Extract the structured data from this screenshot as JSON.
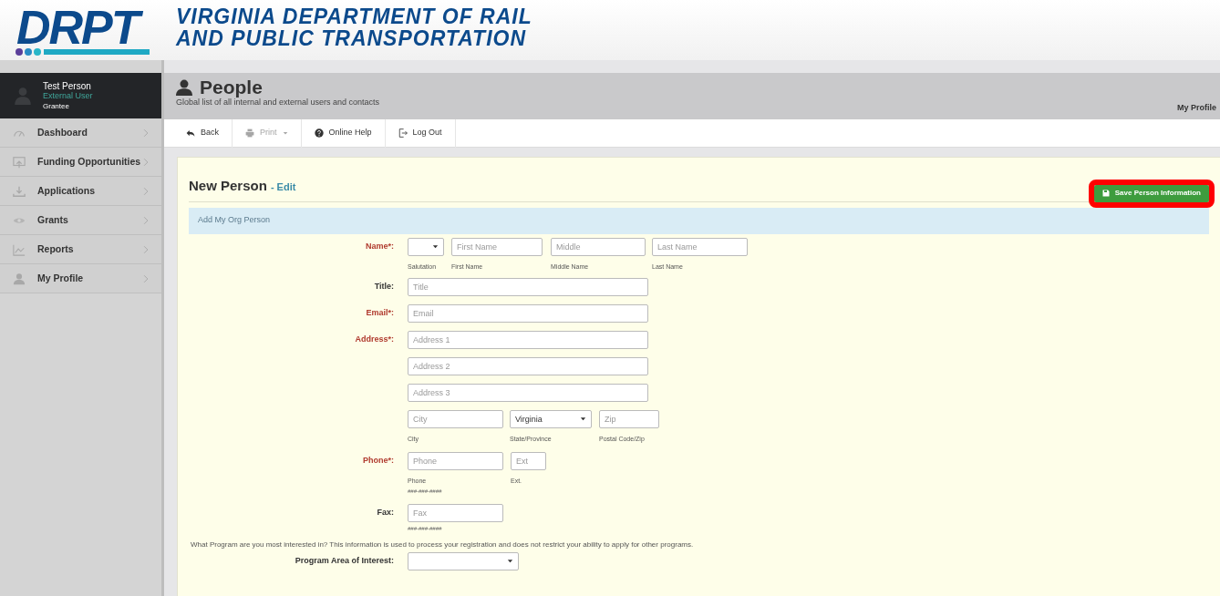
{
  "header": {
    "logo_text": "DRPT",
    "title_lines": [
      "VIRGINIA DEPARTMENT OF RAIL",
      "AND PUBLIC TRANSPORTATION"
    ]
  },
  "user": {
    "name": "Test Person",
    "role": "External User",
    "group": "Grantee"
  },
  "sidebar": {
    "items": [
      {
        "label": "Dashboard"
      },
      {
        "label": "Funding Opportunities"
      },
      {
        "label": "Applications"
      },
      {
        "label": "Grants"
      },
      {
        "label": "Reports"
      },
      {
        "label": "My Profile"
      }
    ]
  },
  "page_header": {
    "title": "People",
    "subtitle": "Global list of all internal and external users and contacts",
    "profile_link": "My Profile"
  },
  "toolbar": [
    {
      "label": "Back",
      "disabled": false,
      "has_menu": false
    },
    {
      "label": "Print",
      "disabled": true,
      "has_menu": true
    },
    {
      "label": "Online Help",
      "disabled": false,
      "has_menu": false
    },
    {
      "label": "Log Out",
      "disabled": false,
      "has_menu": false
    }
  ],
  "form": {
    "title": "New Person",
    "edit_link": "- Edit",
    "save_button": {
      "label": "Save Person Information",
      "highlighted": true
    },
    "section": "Add My Org Person",
    "rows": [
      {
        "label": "Name*:",
        "required": true,
        "fields": [
          {
            "kind": "select",
            "caption": "Salutation"
          },
          {
            "kind": "input",
            "placeholder": "First Name",
            "caption": "First Name"
          },
          {
            "kind": "input",
            "placeholder": "Middle",
            "caption": "Middle Name"
          },
          {
            "kind": "input",
            "placeholder": "Last Name",
            "caption": "Last Name"
          }
        ]
      },
      {
        "label": "Title:",
        "required": false,
        "fields": [
          {
            "kind": "input",
            "placeholder": "Title"
          }
        ]
      },
      {
        "label": "Email*:",
        "required": true,
        "fields": [
          {
            "kind": "input",
            "placeholder": "Email"
          }
        ]
      },
      {
        "label": "Address*:",
        "required": true,
        "fields": [
          {
            "kind": "input",
            "placeholder": "Address 1"
          }
        ]
      },
      {
        "fields": [
          {
            "kind": "input",
            "placeholder": "Address 2"
          }
        ]
      },
      {
        "fields": [
          {
            "kind": "input",
            "placeholder": "Address 3"
          }
        ]
      },
      {
        "fields": [
          {
            "kind": "input",
            "placeholder": "City",
            "caption": "City"
          },
          {
            "kind": "select",
            "value": "Virginia",
            "caption": "State/Province"
          },
          {
            "kind": "input",
            "placeholder": "Zip",
            "caption": "Postal Code/Zip"
          }
        ]
      },
      {
        "label": "Phone*:",
        "required": true,
        "fields": [
          {
            "kind": "input",
            "placeholder": "Phone",
            "caption": "Phone",
            "hint": "###-###-####"
          },
          {
            "kind": "input",
            "placeholder": "Ext",
            "caption": "Ext."
          }
        ]
      },
      {
        "label": "Fax:",
        "required": false,
        "fields": [
          {
            "kind": "input",
            "placeholder": "Fax",
            "hint": "###-###-####"
          }
        ]
      }
    ],
    "note": "What Program are you most interested in? This information is used to process your registration and does not restrict your ability to apply for other programs.",
    "program": {
      "label": "Program Area of Interest:",
      "required": false,
      "fields": [
        {
          "kind": "select"
        }
      ]
    }
  }
}
